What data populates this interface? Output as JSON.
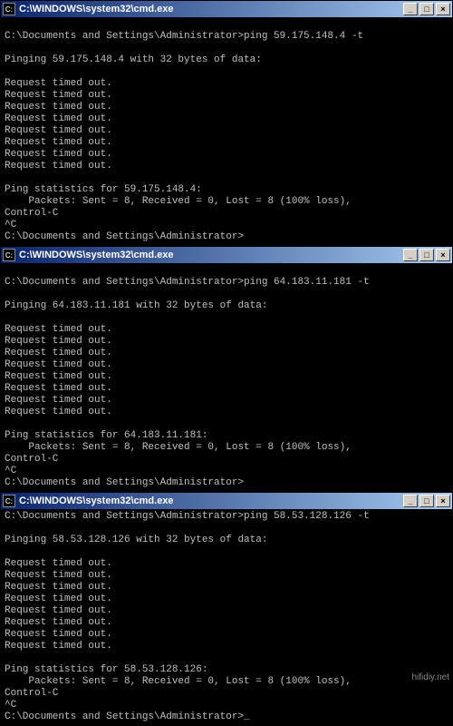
{
  "watermark": "hifidiy.net",
  "windows": [
    {
      "title": "C:\\WINDOWS\\system32\\cmd.exe",
      "icon_label": "cmd-icon",
      "controls": {
        "min": "_",
        "max": "□",
        "close": "×"
      },
      "lines": [
        "",
        "C:\\Documents and Settings\\Administrator>ping 59.175.148.4 -t",
        "",
        "Pinging 59.175.148.4 with 32 bytes of data:",
        "",
        "Request timed out.",
        "Request timed out.",
        "Request timed out.",
        "Request timed out.",
        "Request timed out.",
        "Request timed out.",
        "Request timed out.",
        "Request timed out.",
        "",
        "Ping statistics for 59.175.148.4:",
        "    Packets: Sent = 8, Received = 0, Lost = 8 (100% loss),",
        "Control-C",
        "^C",
        "C:\\Documents and Settings\\Administrator>"
      ]
    },
    {
      "title": "C:\\WINDOWS\\system32\\cmd.exe",
      "icon_label": "cmd-icon",
      "controls": {
        "min": "_",
        "max": "□",
        "close": "×"
      },
      "lines": [
        "",
        "C:\\Documents and Settings\\Administrator>ping 64.183.11.181 -t",
        "",
        "Pinging 64.183.11.181 with 32 bytes of data:",
        "",
        "Request timed out.",
        "Request timed out.",
        "Request timed out.",
        "Request timed out.",
        "Request timed out.",
        "Request timed out.",
        "Request timed out.",
        "Request timed out.",
        "",
        "Ping statistics for 64.183.11.181:",
        "    Packets: Sent = 8, Received = 0, Lost = 8 (100% loss),",
        "Control-C",
        "^C",
        "C:\\Documents and Settings\\Administrator>"
      ]
    },
    {
      "title": "C:\\WINDOWS\\system32\\cmd.exe",
      "icon_label": "cmd-icon",
      "controls": {
        "min": "_",
        "max": "□",
        "close": "×"
      },
      "lines": [
        "C:\\Documents and Settings\\Administrator>ping 58.53.128.126 -t",
        "",
        "Pinging 58.53.128.126 with 32 bytes of data:",
        "",
        "Request timed out.",
        "Request timed out.",
        "Request timed out.",
        "Request timed out.",
        "Request timed out.",
        "Request timed out.",
        "Request timed out.",
        "Request timed out.",
        "",
        "Ping statistics for 58.53.128.126:",
        "    Packets: Sent = 8, Received = 0, Lost = 8 (100% loss),",
        "Control-C",
        "^C",
        "C:\\Documents and Settings\\Administrator>_"
      ]
    }
  ]
}
